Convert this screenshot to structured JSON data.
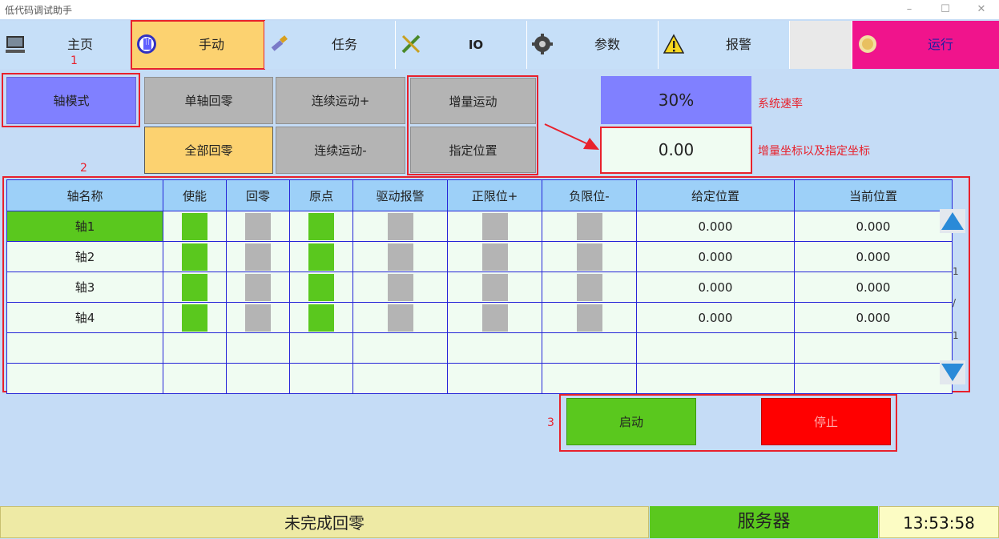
{
  "window": {
    "title": "低代码调试助手",
    "controls": [
      "–",
      "☐",
      "✕"
    ]
  },
  "tabs": [
    {
      "label": "主页",
      "icon": "monitor-icon"
    },
    {
      "label": "手动",
      "icon": "hand-icon"
    },
    {
      "label": "任务",
      "icon": "brush-icon"
    },
    {
      "label": "IO",
      "icon": "plug-icon"
    },
    {
      "label": "参数",
      "icon": "gear-icon"
    },
    {
      "label": "报警",
      "icon": "warning-icon"
    },
    {
      "label": "",
      "icon": ""
    },
    {
      "label": "运行",
      "icon": "run-icon"
    }
  ],
  "annotations": {
    "n1": "1",
    "n2": "2",
    "n3": "3",
    "speed_note": "系统速率",
    "coord_note": "增量坐标以及指定坐标"
  },
  "controls": {
    "axis_mode": "轴模式",
    "single_home": "单轴回零",
    "continuous_plus": "连续运动+",
    "incremental": "增量运动",
    "all_home": "全部回零",
    "continuous_minus": "连续运动-",
    "target_position": "指定位置",
    "speed": "30%",
    "coordinate": "0.00"
  },
  "table": {
    "headers": [
      "轴名称",
      "使能",
      "回零",
      "原点",
      "驱动报警",
      "正限位+",
      "负限位-",
      "给定位置",
      "当前位置"
    ],
    "rows": [
      {
        "name": "轴1",
        "enable": true,
        "home": false,
        "origin": true,
        "alarm": false,
        "pos_limit": false,
        "neg_limit": false,
        "given": "0.000",
        "current": "0.000"
      },
      {
        "name": "轴2",
        "enable": true,
        "home": false,
        "origin": true,
        "alarm": false,
        "pos_limit": false,
        "neg_limit": false,
        "given": "0.000",
        "current": "0.000"
      },
      {
        "name": "轴3",
        "enable": true,
        "home": false,
        "origin": true,
        "alarm": false,
        "pos_limit": false,
        "neg_limit": false,
        "given": "0.000",
        "current": "0.000"
      },
      {
        "name": "轴4",
        "enable": true,
        "home": false,
        "origin": true,
        "alarm": false,
        "pos_limit": false,
        "neg_limit": false,
        "given": "0.000",
        "current": "0.000"
      }
    ],
    "page_current": "1",
    "page_sep": "/",
    "page_total": "1"
  },
  "actions": {
    "start": "启动",
    "stop": "停止"
  },
  "status": {
    "homing": "未完成回零",
    "server": "服务器",
    "time": "13:53:58"
  },
  "colors": {
    "bg": "#c5dcf6",
    "green": "#5ac81e",
    "gray": "#b4b4b4",
    "red": "#e8212c",
    "orange": "#fcd270",
    "purple": "#8080ff",
    "magenta": "#f0148c"
  }
}
